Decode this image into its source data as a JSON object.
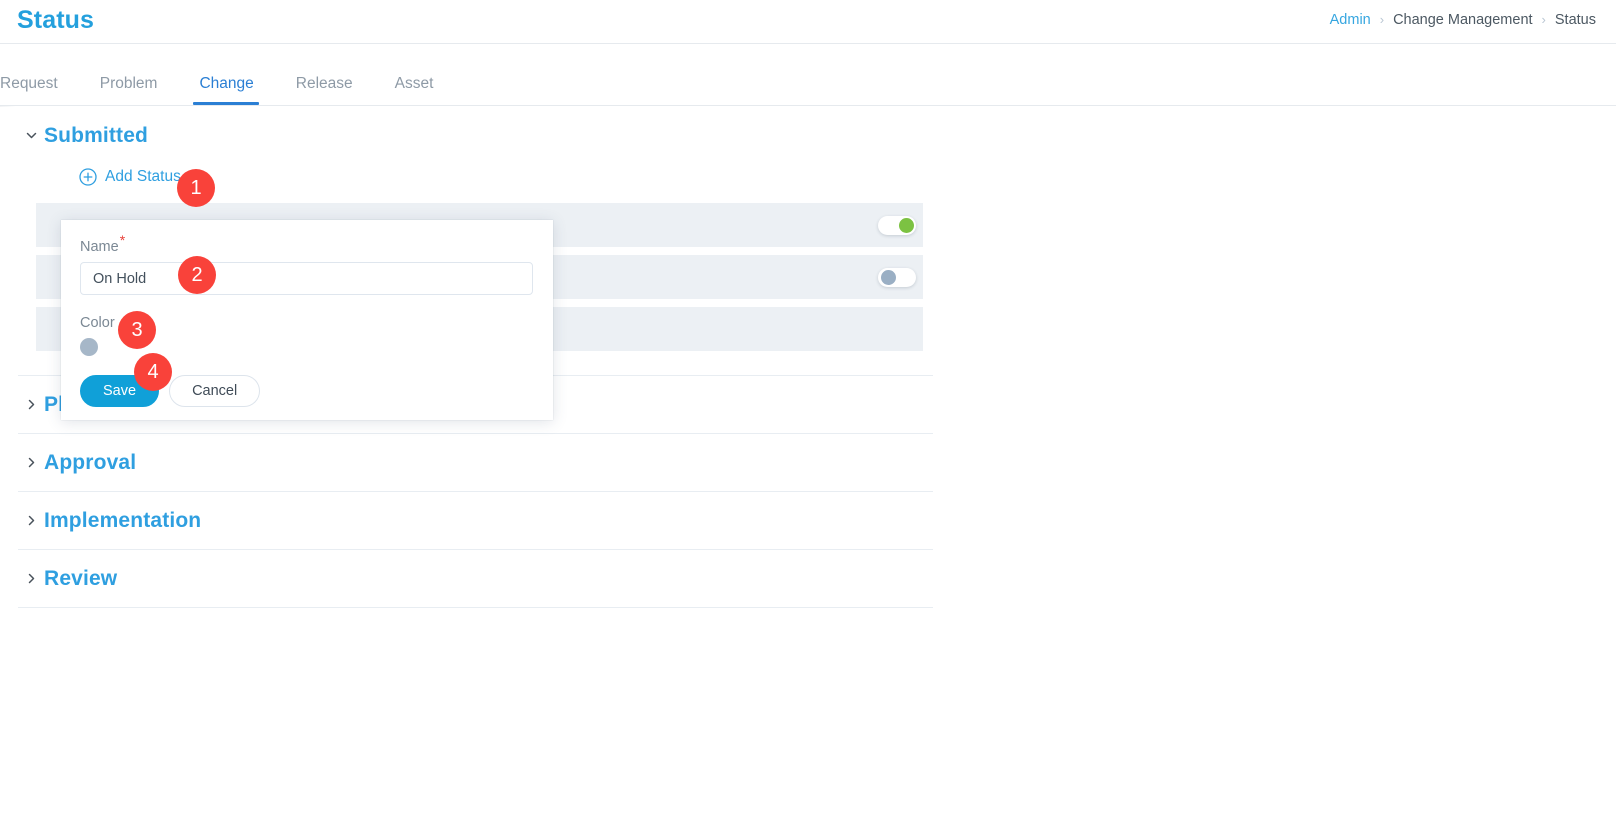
{
  "header": {
    "title": "Status",
    "breadcrumb": [
      {
        "label": "Admin",
        "link": true
      },
      {
        "label": "Change Management",
        "link": false
      },
      {
        "label": "Status",
        "link": false
      }
    ],
    "separator": "›"
  },
  "tabs": [
    {
      "label": "Request",
      "active": false
    },
    {
      "label": "Problem",
      "active": false
    },
    {
      "label": "Change",
      "active": true
    },
    {
      "label": "Release",
      "active": false
    },
    {
      "label": "Asset",
      "active": false
    }
  ],
  "sections": {
    "submitted": {
      "title": "Submitted",
      "expanded": true,
      "caret": "chevron-down-icon",
      "add_status_label": "Add Status",
      "add_status_icon": "plus-circle-icon",
      "rows": [
        {
          "toggle": "on",
          "toggle_color": "#7cc242"
        },
        {
          "toggle": "off",
          "toggle_color": "#9aafc4"
        },
        {
          "toggle": "none",
          "toggle_color": ""
        }
      ]
    },
    "collapsed": [
      {
        "title": "Planning",
        "caret": "chevron-right-icon"
      },
      {
        "title": "Approval",
        "caret": "chevron-right-icon"
      },
      {
        "title": "Implementation",
        "caret": "chevron-right-icon"
      },
      {
        "title": "Review",
        "caret": "chevron-right-icon"
      }
    ]
  },
  "form": {
    "name_label": "Name",
    "required_marker": "*",
    "name_value": "On Hold",
    "name_placeholder": "",
    "color_label": "Color",
    "color_value": "#a6b7c8",
    "save_label": "Save",
    "cancel_label": "Cancel"
  },
  "step_badges": [
    {
      "number": "1"
    },
    {
      "number": "2"
    },
    {
      "number": "3"
    },
    {
      "number": "4"
    }
  ],
  "colors": {
    "accent": "#2f9fe0",
    "title": "#24a0dd",
    "tab_active": "#2b7fd4",
    "badge": "#f9423a",
    "row_bg": "#ecf0f4",
    "save_btn": "#10a0d8"
  }
}
